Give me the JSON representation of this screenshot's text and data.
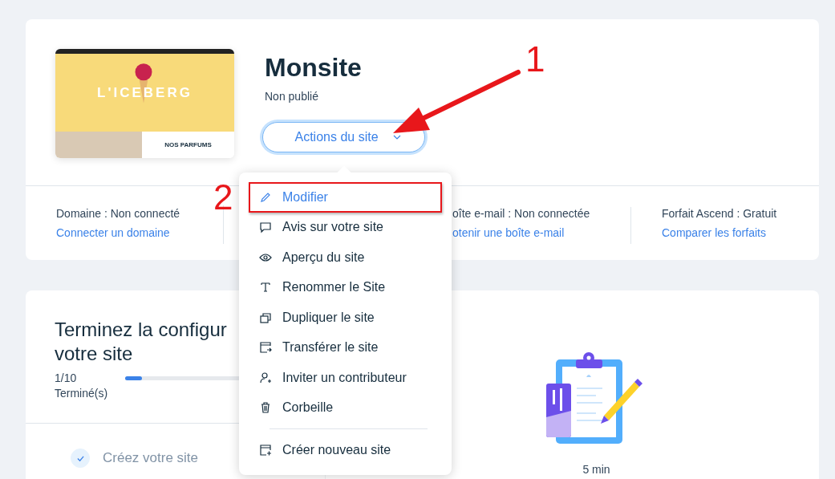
{
  "site": {
    "preview": {
      "headline": "L'ICEBERG",
      "section_title": "NOS PARFUMS"
    },
    "name": "Monsite",
    "status": "Non publié",
    "actions_button": {
      "label": "Actions du site",
      "expanded": true
    }
  },
  "info": [
    {
      "label": "Domaine : Non connecté",
      "link": "Connecter un domaine"
    },
    {
      "label": "oîte e-mail : Non connectée",
      "link": "otenir une boîte e-mail"
    },
    {
      "label": "Forfait Ascend : Gratuit",
      "link": "Comparer les forfaits"
    }
  ],
  "setup": {
    "title_lines": [
      "Terminez la configur",
      "votre site"
    ],
    "count": "1/10",
    "count_label": "Terminé(s)",
    "level": 0.1,
    "steps": [
      {
        "label": "Créez votre site",
        "done": true
      }
    ],
    "duration": "5 min"
  },
  "menu": [
    {
      "kind": "item",
      "label": "Modifier",
      "hovered": true,
      "outlined": true
    },
    {
      "kind": "item",
      "label": "Avis sur votre site",
      "hovered": false,
      "outlined": false
    },
    {
      "kind": "item",
      "label": "Aperçu du site",
      "hovered": false,
      "outlined": false
    },
    {
      "kind": "item",
      "label": "Renommer le Site",
      "hovered": false,
      "outlined": false
    },
    {
      "kind": "item",
      "label": "Dupliquer le site",
      "hovered": false,
      "outlined": false
    },
    {
      "kind": "item",
      "label": "Transférer le site",
      "hovered": false,
      "outlined": false
    },
    {
      "kind": "item",
      "label": "Inviter un contributeur",
      "hovered": false,
      "outlined": false
    },
    {
      "kind": "item",
      "label": "Corbeille",
      "hovered": false,
      "outlined": false
    },
    {
      "kind": "separator"
    },
    {
      "kind": "item",
      "label": "Créer nouveau site",
      "hovered": false,
      "outlined": false
    }
  ],
  "annotations": [
    {
      "kind": "number",
      "text": "1"
    },
    {
      "kind": "arrow"
    },
    {
      "kind": "number",
      "text": "2"
    }
  ]
}
